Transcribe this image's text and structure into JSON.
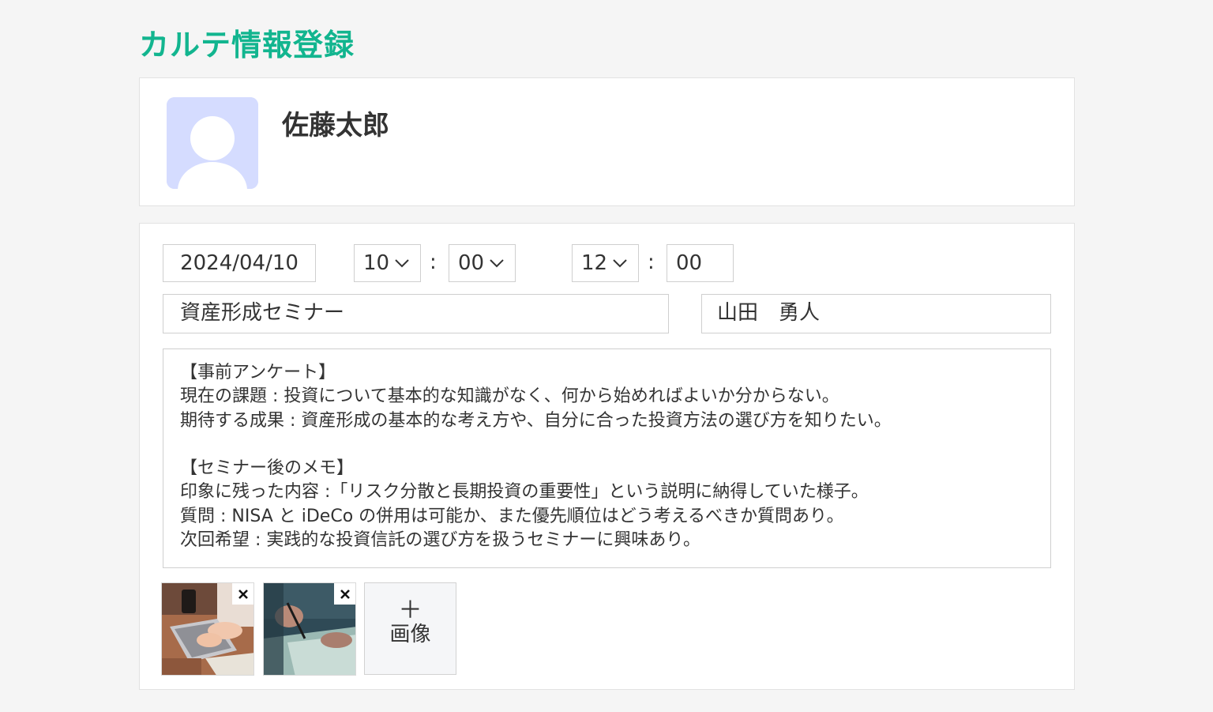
{
  "page": {
    "title": "カルテ情報登録"
  },
  "patient": {
    "name": "佐藤太郎",
    "avatar_icon": "user-silhouette-icon"
  },
  "session": {
    "date": "2024/04/10",
    "start_hour": "10",
    "start_minute": "00",
    "end_hour": "12",
    "end_minute": "00",
    "separator": ":",
    "title": "資産形成セミナー",
    "staff": "山田　勇人"
  },
  "notes": {
    "lines": [
      "【事前アンケート】",
      "現在の課題 : 投資について基本的な知識がなく、何から始めればよいか分からない。",
      "期待する成果 : 資産形成の基本的な考え方や、自分に合った投資方法の選び方を知りたい。",
      "",
      "【セミナー後のメモ】",
      "印象に残った内容 :「リスク分散と長期投資の重要性」という説明に納得していた様子。",
      "質問 : NISA と iDeCo の併用は可能か、また優先順位はどう考えるべきか質問あり。",
      "次回希望 : 実践的な投資信託の選び方を扱うセミナーに興味あり。"
    ]
  },
  "images": {
    "add_plus": "＋",
    "add_label": "画像",
    "remove_icon": "close-icon"
  },
  "colors": {
    "accent": "#12b58f",
    "avatar_bg": "#d5dcff"
  }
}
